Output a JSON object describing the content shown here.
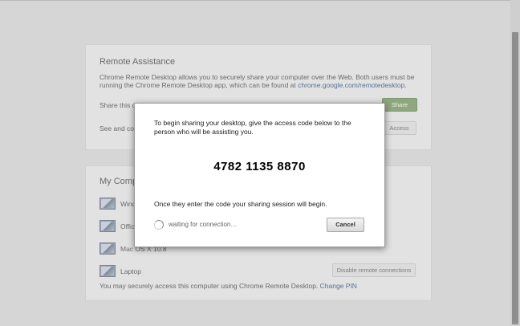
{
  "remote_assistance": {
    "title": "Remote Assistance",
    "description_line1": "Chrome Remote Desktop allows you to securely share your computer over the Web. Both users must be",
    "description_line2_prefix": "running the Chrome Remote Desktop app, which can be found at ",
    "description_link": "chrome.google.com/remotedesktop",
    "description_line2_suffix": ".",
    "share_text": "Share this computer for another user to see and control.",
    "share_button": "Share",
    "access_text": "See and control a shared computer.",
    "access_button": "Access"
  },
  "my_computers": {
    "title": "My Computers",
    "items": [
      {
        "label": "Windows"
      },
      {
        "label": "Office"
      },
      {
        "label": "Mac OS X 10.8"
      },
      {
        "label": "Laptop"
      }
    ],
    "disable_button": "Disable remote connections",
    "footer_text": "You may securely access this computer using Chrome Remote Desktop. ",
    "change_pin_link": "Change PIN"
  },
  "dialog": {
    "instruction": "To begin sharing your desktop, give the access code below to the person who will be assisting you.",
    "access_code": "4782 1135 8870",
    "after_text": "Once they enter the code your sharing session will begin.",
    "waiting_text": "waiting for connection…",
    "cancel_button": "Cancel"
  },
  "colors": {
    "background": "#d6d6d6",
    "card": "#e2e2e2",
    "share_button": "#8ea77f",
    "link": "#5a6f93"
  },
  "icons": [
    "computer-icon",
    "spinner-icon"
  ]
}
